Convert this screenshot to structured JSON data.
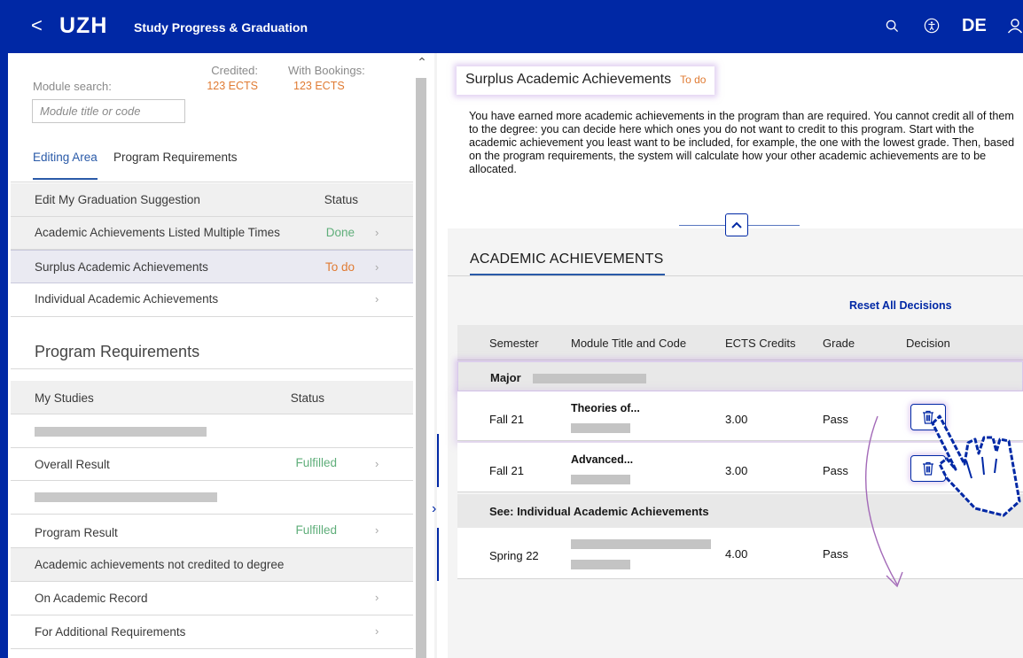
{
  "header": {
    "back_label": "<",
    "logo": "UZH",
    "title": "Study Progress & Graduation",
    "lang": "DE"
  },
  "left": {
    "module_search_label": "Module search:",
    "credited_label": "Credited:",
    "credited_value": "123 ECTS",
    "bookings_label": "With Bookings:",
    "bookings_value": "123 ECTS",
    "search_placeholder": "Module title or code",
    "tabs": [
      "Editing Area",
      "Program Requirements"
    ],
    "edit_rows": [
      {
        "label": "Edit My Graduation Suggestion",
        "status": "Status"
      },
      {
        "label": "Academic Achievements Listed Multiple Times",
        "status": "Done"
      },
      {
        "label": "Surplus Academic Achievements",
        "status": "To do"
      },
      {
        "label": "Individual Academic Achievements",
        "status": ""
      }
    ],
    "program_title": "Program Requirements",
    "prog_rows": [
      {
        "label": "My Studies",
        "status": "Status"
      },
      {
        "label": "Overall Result",
        "status": "Fulfilled"
      },
      {
        "label": "Program Result",
        "status": "Fulfilled"
      },
      {
        "label": "Academic achievements not credited to degree",
        "status": ""
      },
      {
        "label": "On Academic Record",
        "status": ""
      },
      {
        "label": "For Additional Requirements",
        "status": ""
      }
    ]
  },
  "right": {
    "surplus_title": "Surplus Academic Achievements",
    "surplus_status": "To do",
    "description": "You have earned more academic achievements in the program than are required. You cannot credit all of them to the degree: you can decide here which ones you do not want to credit to this program. Start with the academic achievement you least want to be included, for example, the one with the lowest grade. Then, based on the program requirements, the system will calculate how your other academic achievements are to be allocated.",
    "section_title": "ACADEMIC ACHIEVEMENTS",
    "reset_label": "Reset All Decisions",
    "columns": [
      "Semester",
      "Module Title and Code",
      "ECTS Credits",
      "Grade",
      "Decision"
    ],
    "group_major": "Major",
    "group_individual": "See: Individual Academic Achievements",
    "rows": [
      {
        "semester": "Fall 21",
        "module": "Theories of...",
        "ects": "3.00",
        "grade": "Pass"
      },
      {
        "semester": "Fall 21",
        "module": "Advanced...",
        "ects": "3.00",
        "grade": "Pass"
      },
      {
        "semester": "Spring 22",
        "module": "",
        "ects": "4.00",
        "grade": "Pass"
      }
    ]
  },
  "colors": {
    "brand_blue": "#0028a5",
    "todo_orange": "#e07b33",
    "done_green": "#5fae7a",
    "highlight_purple": "#c8aae6"
  }
}
